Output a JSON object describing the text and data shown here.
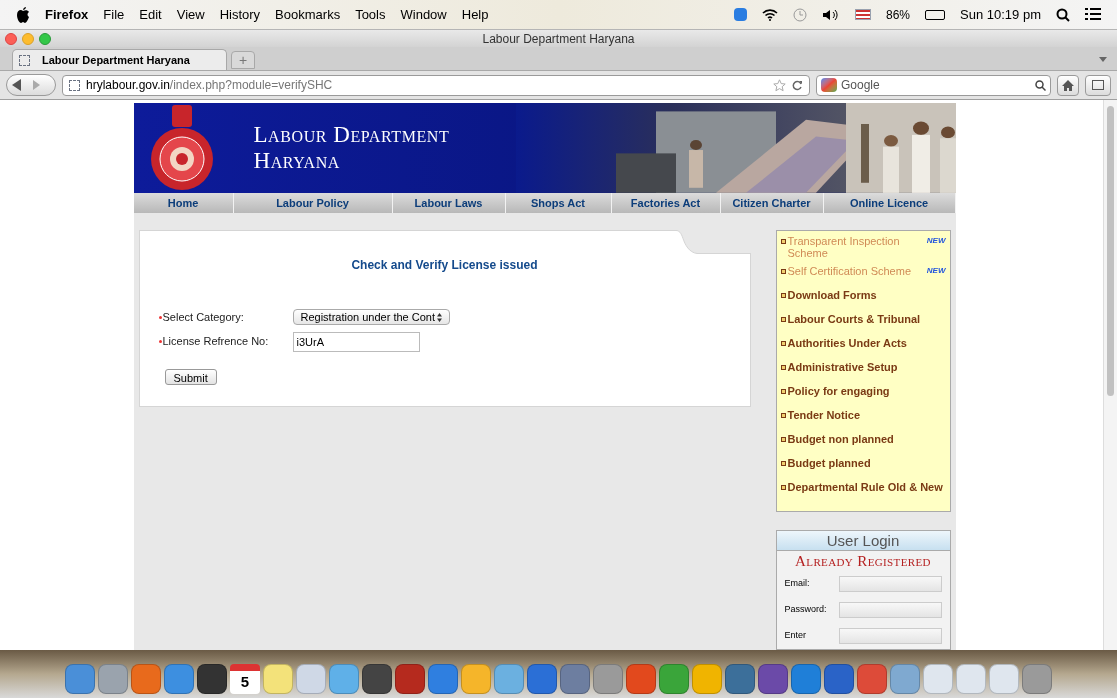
{
  "menu_bar": {
    "app": "Firefox",
    "items": [
      "File",
      "Edit",
      "View",
      "History",
      "Bookmarks",
      "Tools",
      "Window",
      "Help"
    ],
    "battery": "86%",
    "clock": "Sun 10:19 pm"
  },
  "window": {
    "title": "Labour Department Haryana"
  },
  "tabs": [
    {
      "label": "Labour Department Haryana",
      "selected": true
    }
  ],
  "new_tab": "+",
  "address_bar": {
    "domain": "hrylabour.gov.in",
    "path": "/index.php?module=verifySHC"
  },
  "search": {
    "placeholder": "Google"
  },
  "site": {
    "title_line_1": "Labour Department",
    "title_line_2": "Haryana",
    "nav": [
      "Home",
      "Labour Policy",
      "Labour Laws",
      "Shops Act",
      "Factories Act",
      "Citizen Charter",
      "Online Licence"
    ],
    "form": {
      "title": "Check and Verify License issued",
      "fields": [
        {
          "kind": "select",
          "label": "Select Category:",
          "value": "Registration under the Cont"
        },
        {
          "kind": "text",
          "label": "License Refrence No:",
          "value": "i3UrA"
        }
      ],
      "submit": "Submit"
    },
    "links": [
      {
        "label": "Transparent Inspection Scheme",
        "new": true,
        "badge": "NEW"
      },
      {
        "label": "Self Certification Scheme",
        "new": true,
        "badge": "NEW"
      },
      {
        "label": "Download Forms",
        "new": false
      },
      {
        "label": "Labour Courts & Tribunal",
        "new": false
      },
      {
        "label": "Authorities Under Acts",
        "new": false
      },
      {
        "label": "Administrative Setup",
        "new": false
      },
      {
        "label": "Policy for engaging",
        "new": false
      },
      {
        "label": "Tender Notice",
        "new": false
      },
      {
        "label": "Budget non planned",
        "new": false
      },
      {
        "label": "Budget planned",
        "new": false
      },
      {
        "label": "Departmental Rule Old & New",
        "new": false
      }
    ],
    "login": {
      "title": "User Login",
      "subtitle": "Already Registered",
      "fields": [
        "Email:",
        "Password:",
        "Enter"
      ]
    }
  },
  "dock": {
    "calendar_day": "5"
  }
}
